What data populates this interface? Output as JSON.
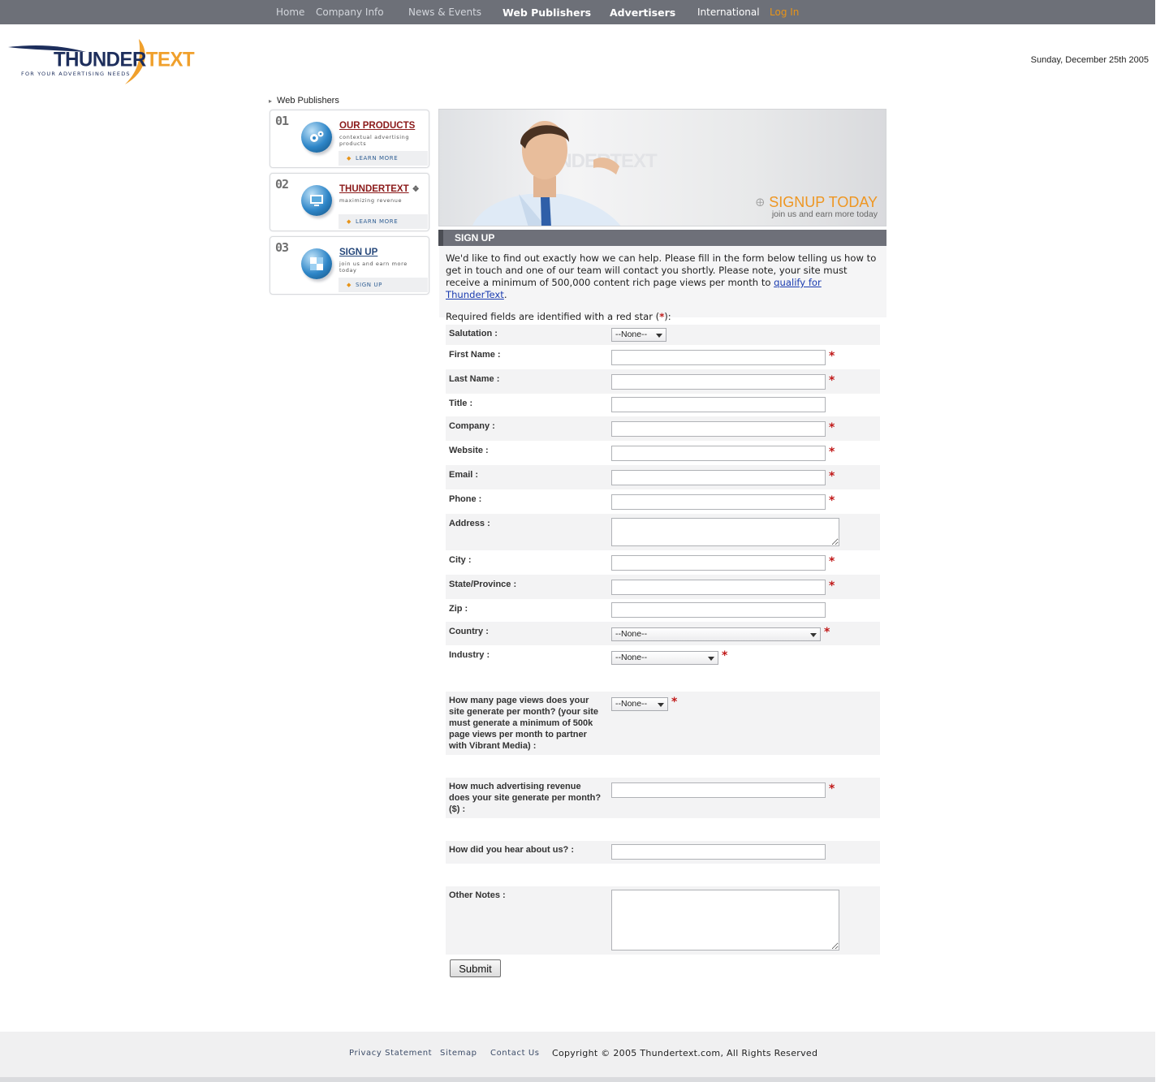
{
  "nav": {
    "home": "Home",
    "company_info": "Company Info",
    "news_events": "News & Events",
    "web_publishers": "Web Publishers",
    "advertisers": "Advertisers",
    "international": "International",
    "login": "Log In"
  },
  "logo": {
    "word_a": "THUNDER",
    "word_b": "TEXT",
    "tagline": "FOR YOUR ADVERTISING NEEDS"
  },
  "date": "Sunday, December 25th 2005",
  "breadcrumb": "Web Publishers",
  "cards": [
    {
      "num": "01",
      "title": "OUR PRODUCTS",
      "sub": "CONTEXTUAL ADVERTISING PRODUCTS",
      "link": "LEARN MORE"
    },
    {
      "num": "02",
      "title": "THUNDERTEXT",
      "sub": "MAXIMIZING REVENUE",
      "link": "LEARN MORE"
    },
    {
      "num": "03",
      "title": "SIGN UP",
      "sub": "JOIN US AND EARN MORE TODAY",
      "link": "SIGN UP"
    }
  ],
  "banner": {
    "ghost": "UNDERTEXT",
    "headline": "SIGNUP TODAY",
    "subline": "join us and earn more today"
  },
  "signup": {
    "heading": "SIGN UP",
    "intro": "We'd like to find out exactly how we can help. Please fill in the form below telling us how to get in touch and one of our team will contact you shortly. Please note, your site must receive a minimum of 500,000 content rich page views per month to ",
    "intro_link": "qualify for ThunderText",
    "intro_end": ".",
    "required_a": "Required fields are identified with a red star (",
    "required_star": "*",
    "required_b": "):"
  },
  "form": {
    "salutation": "Salutation :",
    "first_name": "First Name :",
    "last_name": "Last Name :",
    "title": "Title :",
    "company": "Company :",
    "website": "Website :",
    "email": "Email :",
    "phone": "Phone :",
    "address": "Address :",
    "city": "City :",
    "state": "State/Province :",
    "zip": "Zip :",
    "country": "Country :",
    "industry": "Industry :",
    "pageviews": "How many page views does your site generate per month? (your site must generate a minimum of 500k page views per month to partner with Vibrant Media) :",
    "revenue": "How much advertising revenue does your site generate per month? ($) :",
    "hear": "How did you hear about us? :",
    "notes": "Other Notes :",
    "none_option": "--None--",
    "star": "*",
    "submit": "Submit"
  },
  "footer": {
    "privacy": "Privacy Statement",
    "sitemap": "Sitemap",
    "contact": "Contact Us",
    "copyright": "Copyright © 2005 Thundertext.com, All Rights Reserved"
  },
  "colors": {
    "nav_bg": "#6d7078",
    "accent_orange": "#e89418",
    "required_red": "#c01818",
    "header_grey": "#6e7079"
  }
}
